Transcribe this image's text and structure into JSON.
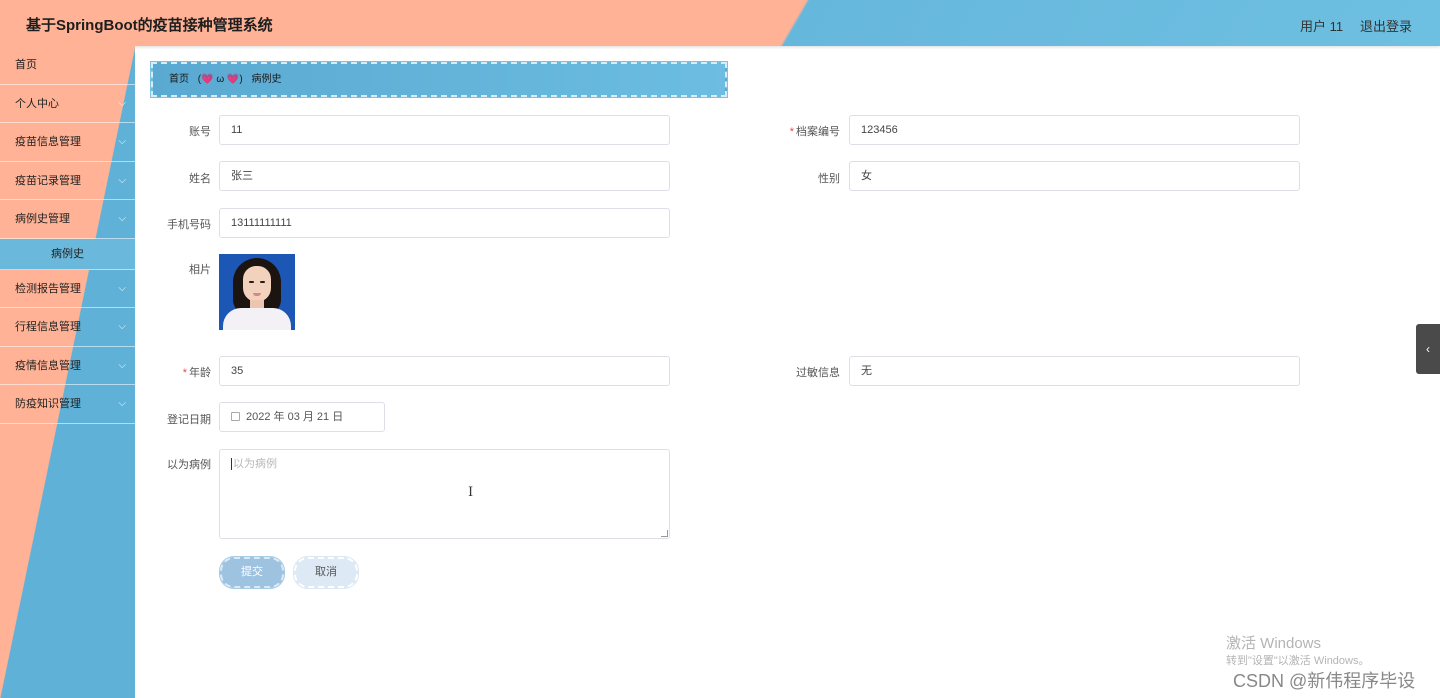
{
  "header": {
    "title": "基于SpringBoot的疫苗接种管理系统",
    "user": "用户 11",
    "logout": "退出登录"
  },
  "sidebar": {
    "items": [
      {
        "label": "首页",
        "expandable": false
      },
      {
        "label": "个人中心",
        "expandable": true
      },
      {
        "label": "疫苗信息管理",
        "expandable": true
      },
      {
        "label": "疫苗记录管理",
        "expandable": true
      },
      {
        "label": "病例史管理",
        "expandable": true
      },
      {
        "label": "病例史",
        "sub": true
      },
      {
        "label": "检测报告管理",
        "expandable": true
      },
      {
        "label": "行程信息管理",
        "expandable": true
      },
      {
        "label": "疫情信息管理",
        "expandable": true
      },
      {
        "label": "防疫知识管理",
        "expandable": true
      }
    ]
  },
  "breadcrumb": {
    "home": "首页",
    "separator": "(💗 ω 💗)",
    "current": "病例史"
  },
  "form": {
    "account": {
      "label": "账号",
      "value": "11"
    },
    "file_no": {
      "label": "档案编号",
      "value": "123456",
      "required": true
    },
    "name": {
      "label": "姓名",
      "value": "张三"
    },
    "gender": {
      "label": "性别",
      "value": "女"
    },
    "phone": {
      "label": "手机号码",
      "value": "13111111111"
    },
    "photo": {
      "label": "相片"
    },
    "age": {
      "label": "年龄",
      "value": "35",
      "required": true
    },
    "allergy": {
      "label": "过敏信息",
      "value": "无"
    },
    "reg_date": {
      "label": "登记日期",
      "value": "2022 年 03 月 21 日"
    },
    "past_cases": {
      "label": "以为病例",
      "placeholder": "以为病例"
    }
  },
  "buttons": {
    "submit": "提交",
    "cancel": "取消"
  },
  "watermark": {
    "line1": "激活 Windows",
    "line2": "转到\"设置\"以激活 Windows。",
    "line3": "CSDN @新伟程序毕设"
  },
  "colors": {
    "header_peach": "#ffb295",
    "header_blue": "#6ec0e2",
    "active_menu": "#6ab8dc",
    "required_star": "#e84c3d"
  },
  "icons": {
    "menu_expand": "chevron-down-icon",
    "date": "calendar-icon",
    "side_toggle": "chevron-left-icon"
  }
}
